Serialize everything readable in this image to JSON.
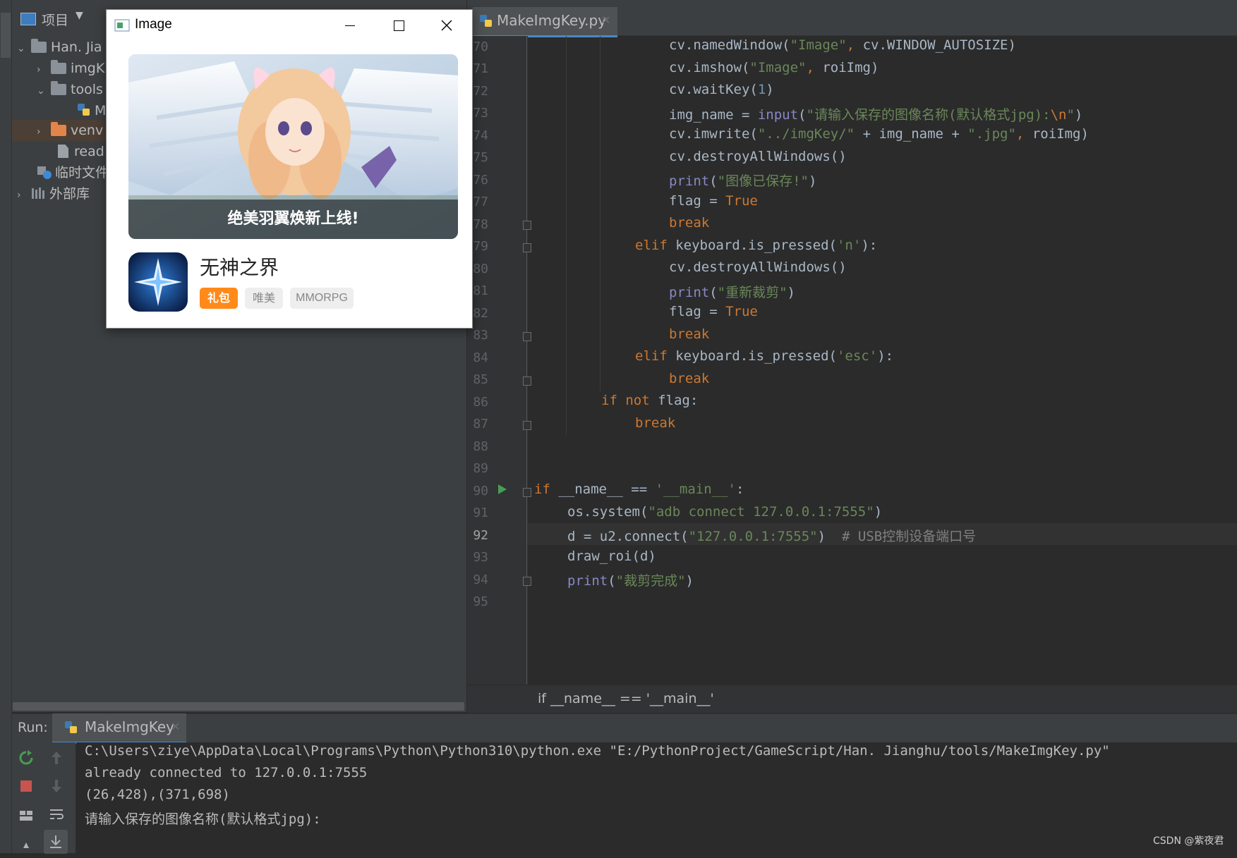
{
  "project_panel": {
    "title": "项目",
    "side_tab": "项目",
    "tree": [
      {
        "label": "Han. Jia",
        "type": "folder",
        "expanded": true
      },
      {
        "label": "imgK",
        "type": "folder",
        "expanded": false
      },
      {
        "label": "tools",
        "type": "folder",
        "expanded": true
      },
      {
        "label": "M",
        "type": "python-file"
      },
      {
        "label": "venv",
        "type": "folder-orange",
        "expanded": false
      },
      {
        "label": "read",
        "type": "file"
      },
      {
        "label": "临时文件",
        "type": "scratches"
      },
      {
        "label": "外部库",
        "type": "library"
      }
    ]
  },
  "editor": {
    "tab_label": "MakeImgKey.py",
    "current_line": "92",
    "breadcrumb": "if __name__ == '__main__'",
    "line_numbers": [
      "70",
      "71",
      "72",
      "73",
      "74",
      "75",
      "76",
      "77",
      "78",
      "79",
      "80",
      "81",
      "82",
      "83",
      "84",
      "85",
      "86",
      "87",
      "88",
      "89",
      "90",
      "91",
      "92",
      "93",
      "94",
      "95"
    ],
    "code": {
      "l70_a": "cv.namedWindow(",
      "l70_b": "\"Image\"",
      "l70_c": ", ",
      "l70_d": "cv.WINDOW_AUTOSIZE)",
      "l71_a": "cv.imshow(",
      "l71_b": "\"Image\"",
      "l71_c": ", ",
      "l71_d": "roiImg)",
      "l72_a": "cv.waitKey(",
      "l72_b": "1",
      "l72_c": ")",
      "l73_a": "img_name = ",
      "l73_b": "input",
      "l73_c": "(",
      "l73_d": "\"请输入保存的图像名称(默认格式jpg):",
      "l73_e": "\\n",
      "l73_f": "\"",
      "l73_g": ")",
      "l74_a": "cv.imwrite(",
      "l74_b": "\"../imgKey/\"",
      "l74_c": " + img_name + ",
      "l74_d": "\".jpg\"",
      "l74_e": ", ",
      "l74_f": "roiImg)",
      "l75": "cv.destroyAllWindows()",
      "l76_a": "print",
      "l76_b": "(",
      "l76_c": "\"图像已保存!\"",
      "l76_d": ")",
      "l77_a": "flag = ",
      "l77_b": "True",
      "l78": "break",
      "l79_a": "elif ",
      "l79_b": "keyboard.is_pressed(",
      "l79_c": "'n'",
      "l79_d": "):",
      "l80": "cv.destroyAllWindows()",
      "l81_a": "print",
      "l81_b": "(",
      "l81_c": "\"重新裁剪\"",
      "l81_d": ")",
      "l82_a": "flag = ",
      "l82_b": "True",
      "l83": "break",
      "l84_a": "elif ",
      "l84_b": "keyboard.is_pressed(",
      "l84_c": "'esc'",
      "l84_d": "):",
      "l85": "break",
      "l86_a": "if not ",
      "l86_b": "flag:",
      "l87": "break",
      "l90_a": "if ",
      "l90_b": "__name__ == ",
      "l90_c": "'__main__'",
      "l90_d": ":",
      "l91_a": "os.system(",
      "l91_b": "\"adb connect 127.0.0.1:7555\"",
      "l91_c": ")",
      "l92_a": "d = u2.connect(",
      "l92_b": "\"127.0.0.1:7555\"",
      "l92_c": ")  ",
      "l92_d": "# USB控制设备端口号",
      "l93": "draw_roi(d)",
      "l94_a": "print",
      "l94_b": "(",
      "l94_c": "\"裁剪完成\"",
      "l94_d": ")"
    }
  },
  "run_panel": {
    "label": "Run:",
    "tab_label": "MakeImgKey",
    "output": [
      "C:\\Users\\ziye\\AppData\\Local\\Programs\\Python\\Python310\\python.exe \"E:/PythonProject/GameScript/Han. Jianghu/tools/MakeImgKey.py\"",
      "already connected to 127.0.0.1:7555",
      "(26,428),(371,698)",
      "请输入保存的图像名称(默认格式jpg):"
    ]
  },
  "image_window": {
    "title": "Image",
    "banner_caption": "绝美羽翼焕新上线!",
    "game_title": "无神之界",
    "tags": [
      "礼包",
      "唯美",
      "MMORPG"
    ]
  },
  "watermark": "CSDN @紫夜君",
  "colors": {
    "keyword": "#cc7832",
    "string": "#6a8759",
    "number": "#6897bb",
    "builtin": "#8888c6",
    "comment": "#808080",
    "accent": "#4a88c7",
    "tag_orange": "#ff8a1a"
  }
}
